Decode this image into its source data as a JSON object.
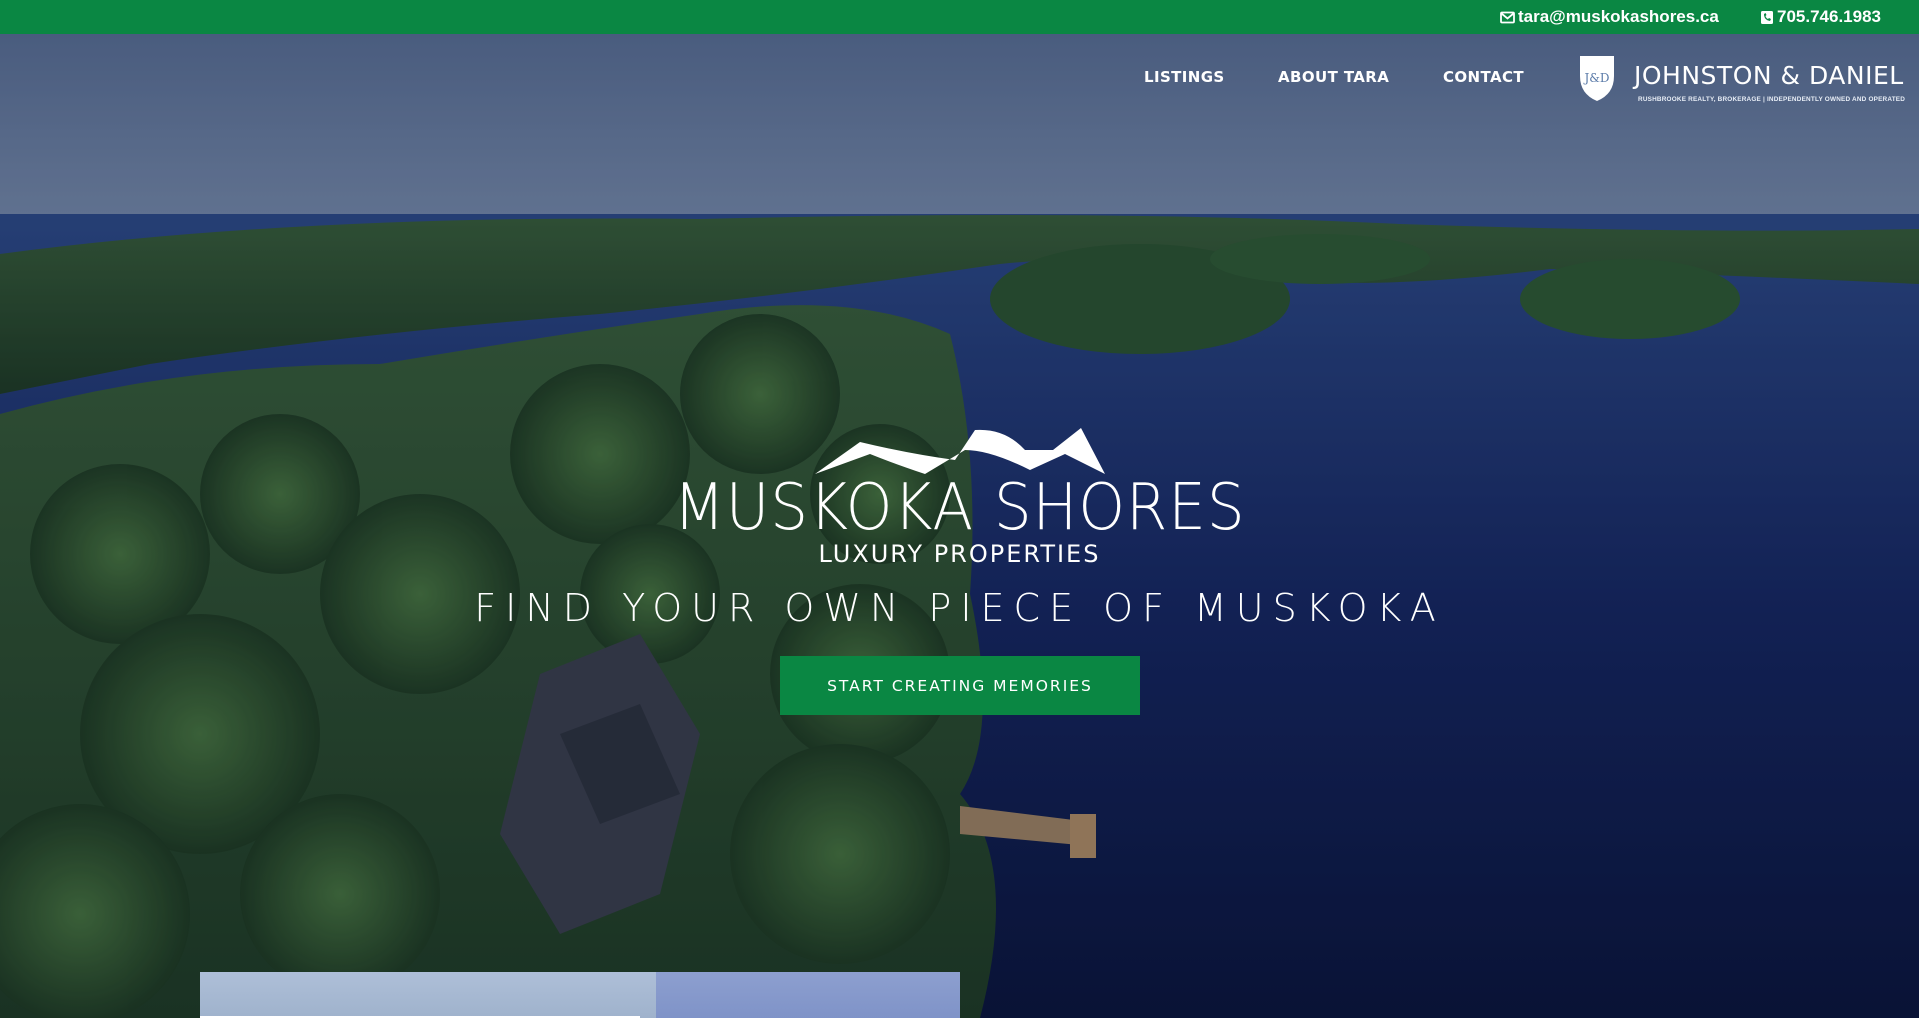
{
  "topbar": {
    "email": "tara@muskokashores.ca",
    "phone": "705.746.1983",
    "email_icon": "envelope-icon",
    "phone_icon": "phone-icon",
    "background": "#0a8743"
  },
  "nav": {
    "items": [
      {
        "label": "LISTINGS"
      },
      {
        "label": "ABOUT TARA"
      },
      {
        "label": "CONTACT"
      }
    ]
  },
  "brokerage": {
    "name": "JOHNSTON & DANIEL",
    "tagline": "RUSHBROOKE REALTY, BROKERAGE | INDEPENDENTLY OWNED AND OPERATED",
    "monogram": "J&D"
  },
  "hero": {
    "brand_title": "MUSKOKA SHORES",
    "brand_subtitle": "LUXURY PROPERTIES",
    "tagline": "FIND YOUR OWN PIECE OF MUSKOKA",
    "cta_label": "START CREATING MEMORIES",
    "accent": "#0a8743"
  }
}
